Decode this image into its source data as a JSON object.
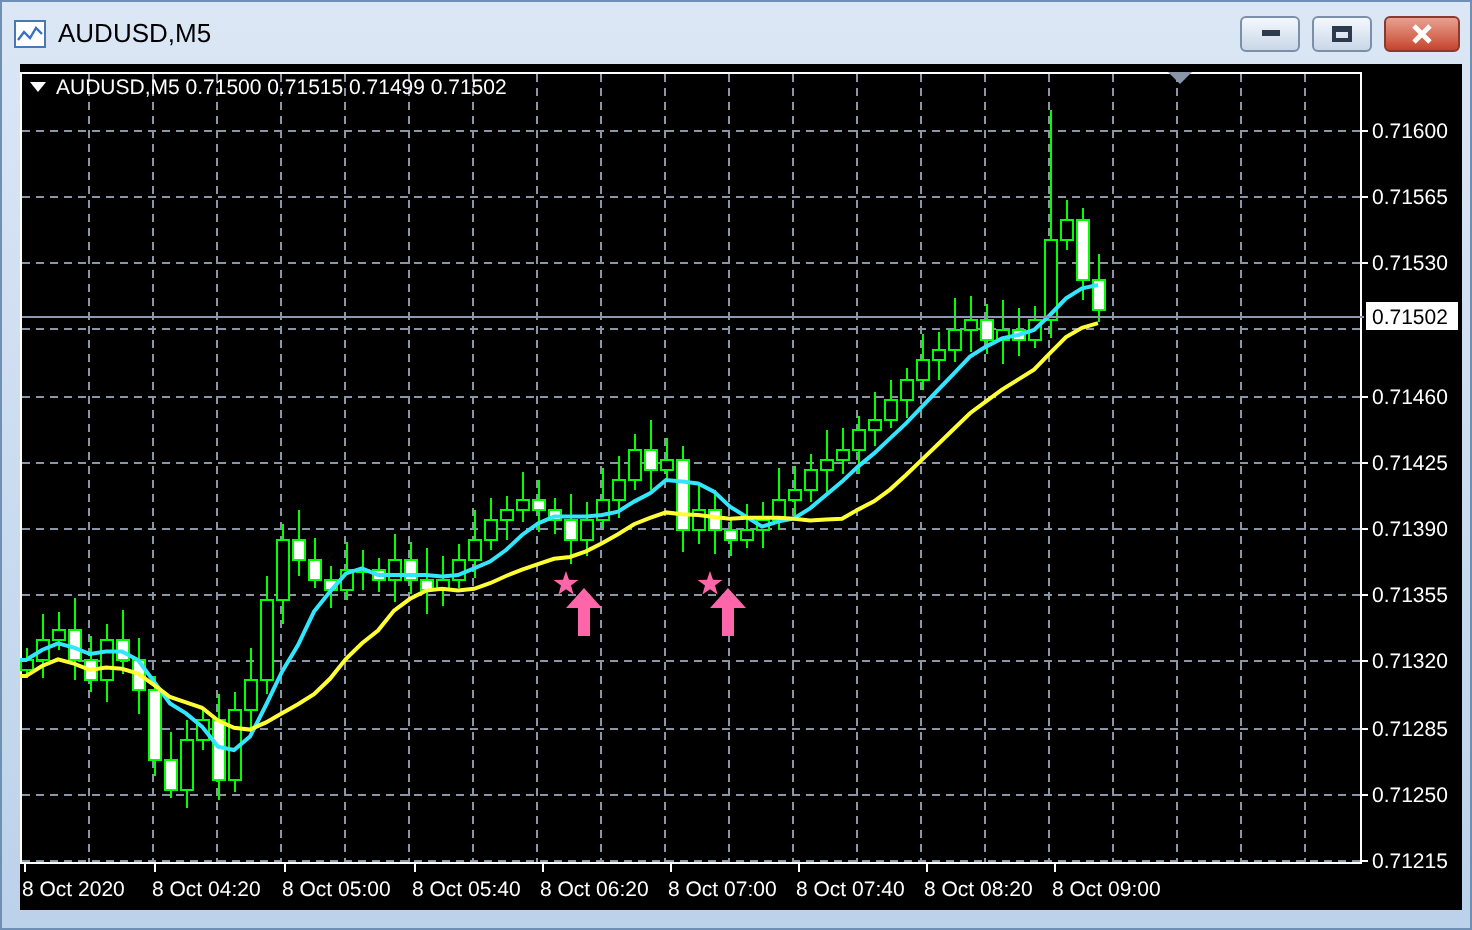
{
  "window": {
    "title": "AUDUSD,M5"
  },
  "chart": {
    "header": {
      "symbol": "AUDUSD,M5",
      "ohlc": [
        "0.71500",
        "0.71515",
        "0.71499",
        "0.71502"
      ]
    },
    "price_axis": [
      "0.71600",
      "0.71565",
      "0.71530",
      "0.71460",
      "0.71425",
      "0.71390",
      "0.71355",
      "0.71320",
      "0.71285",
      "0.71250",
      "0.71215"
    ],
    "current_price": "0.71502",
    "time_axis": [
      "8 Oct 2020",
      "8 Oct 04:20",
      "8 Oct 05:00",
      "8 Oct 05:40",
      "8 Oct 06:20",
      "8 Oct 07:00",
      "8 Oct 07:40",
      "8 Oct 08:20",
      "8 Oct 09:00"
    ]
  }
}
